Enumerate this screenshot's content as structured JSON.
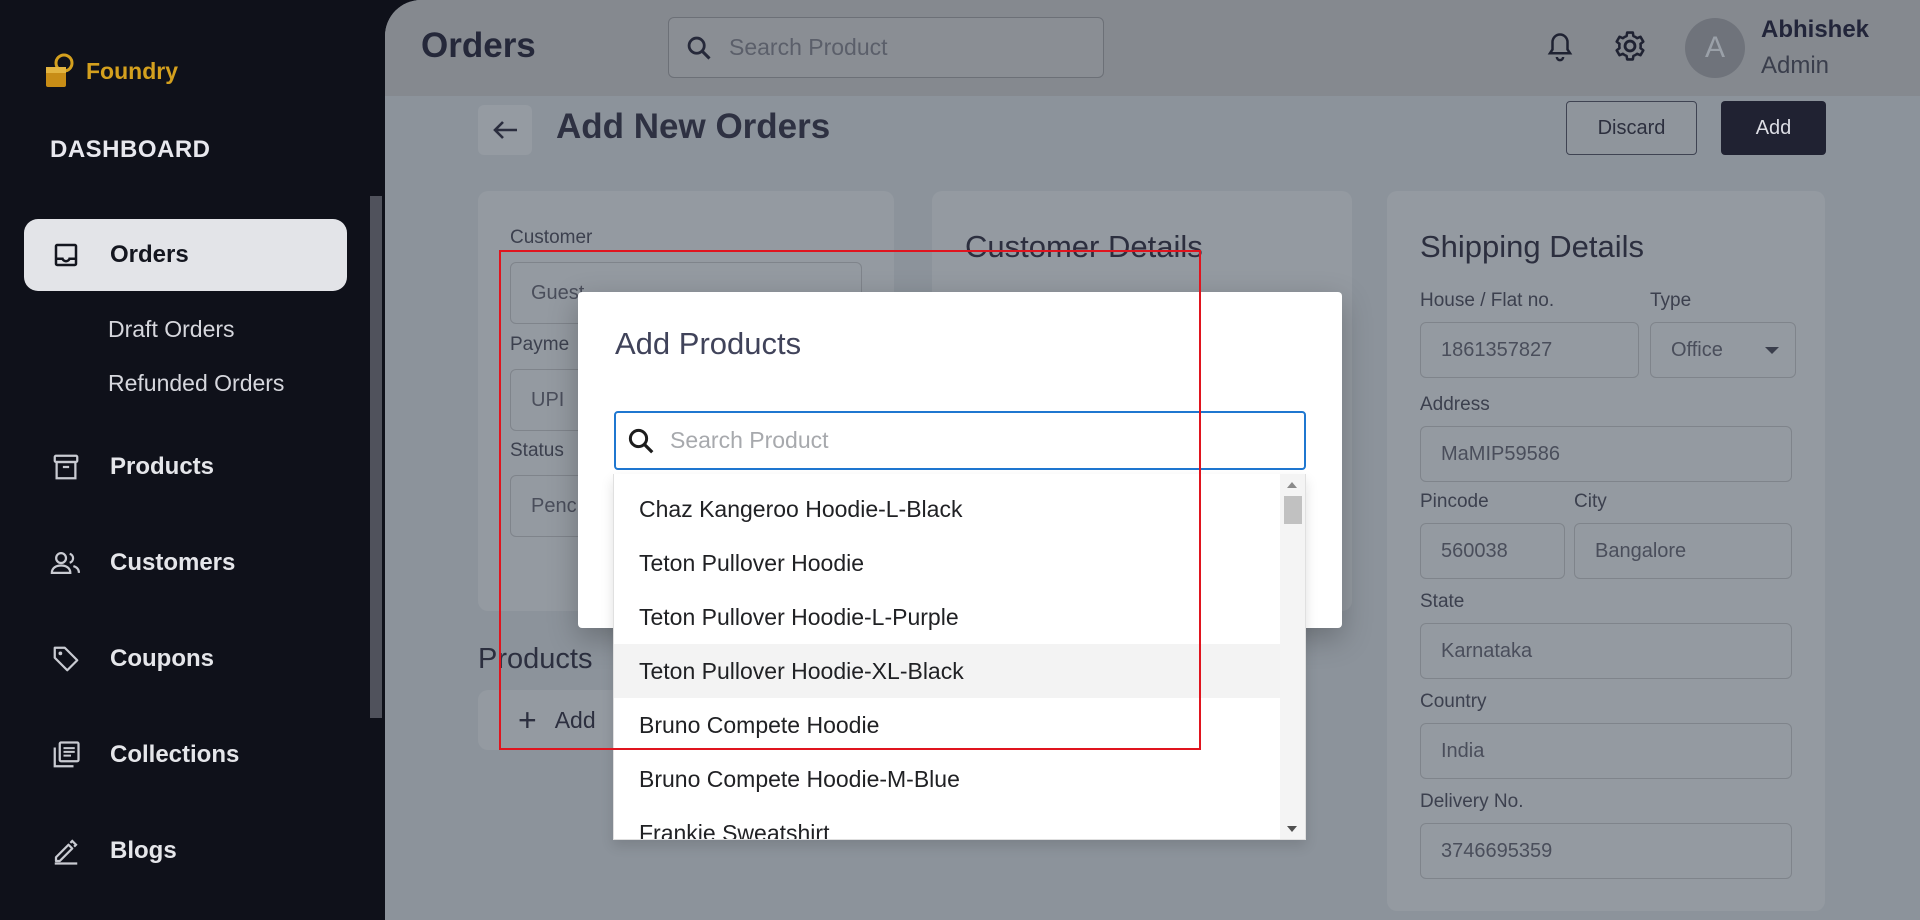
{
  "brand": {
    "name": "Foundry"
  },
  "sidebar": {
    "section_title": "DASHBOARD",
    "items": [
      {
        "label": "Orders",
        "icon": "inbox-icon",
        "active": true
      },
      {
        "label": "Products",
        "icon": "archive-icon"
      },
      {
        "label": "Customers",
        "icon": "people-icon"
      },
      {
        "label": "Coupons",
        "icon": "tag-icon"
      },
      {
        "label": "Collections",
        "icon": "library-icon"
      },
      {
        "label": "Blogs",
        "icon": "edit-icon"
      }
    ],
    "sub_items": [
      "Draft Orders",
      "Refunded Orders"
    ]
  },
  "header": {
    "title": "Orders",
    "search_placeholder": "Search Product",
    "user": {
      "initial": "A",
      "name": "Abhishek",
      "role": "Admin"
    }
  },
  "page": {
    "title": "Add New Orders",
    "discard_label": "Discard",
    "add_label": "Add"
  },
  "order_form": {
    "customer_label": "Customer",
    "customer_value": "Guest",
    "payment_label": "Payme",
    "payment_value": "UPI",
    "status_label": "Status",
    "status_value": "Penc"
  },
  "customer_details": {
    "heading": "Customer Details"
  },
  "products_section": {
    "heading": "Products",
    "add_label": "Add"
  },
  "shipping": {
    "heading": "Shipping Details",
    "house_label": "House / Flat no.",
    "house_value": "1861357827",
    "type_label": "Type",
    "type_value": "Office",
    "address_label": "Address",
    "address_value": "MaMIP59586",
    "pincode_label": "Pincode",
    "pincode_value": "560038",
    "city_label": "City",
    "city_value": "Bangalore",
    "state_label": "State",
    "state_value": "Karnataka",
    "country_label": "Country",
    "country_value": "India",
    "delivery_label": "Delivery No.",
    "delivery_value": "3746695359"
  },
  "modal": {
    "title": "Add Products",
    "search_placeholder": "Search Product",
    "search_value": "",
    "products": [
      "Chaz Kangeroo Hoodie-L-Black",
      "Teton Pullover Hoodie",
      "Teton Pullover Hoodie-L-Purple",
      "Teton Pullover Hoodie-XL-Black",
      "Bruno Compete Hoodie",
      "Bruno Compete Hoodie-M-Blue",
      "Frankie Sweatshirt"
    ]
  },
  "colors": {
    "sidebar_bg": "#0f111a",
    "brand": "#d4a01e",
    "focus_border": "#1f77d0",
    "annotation": "#e0141e"
  }
}
